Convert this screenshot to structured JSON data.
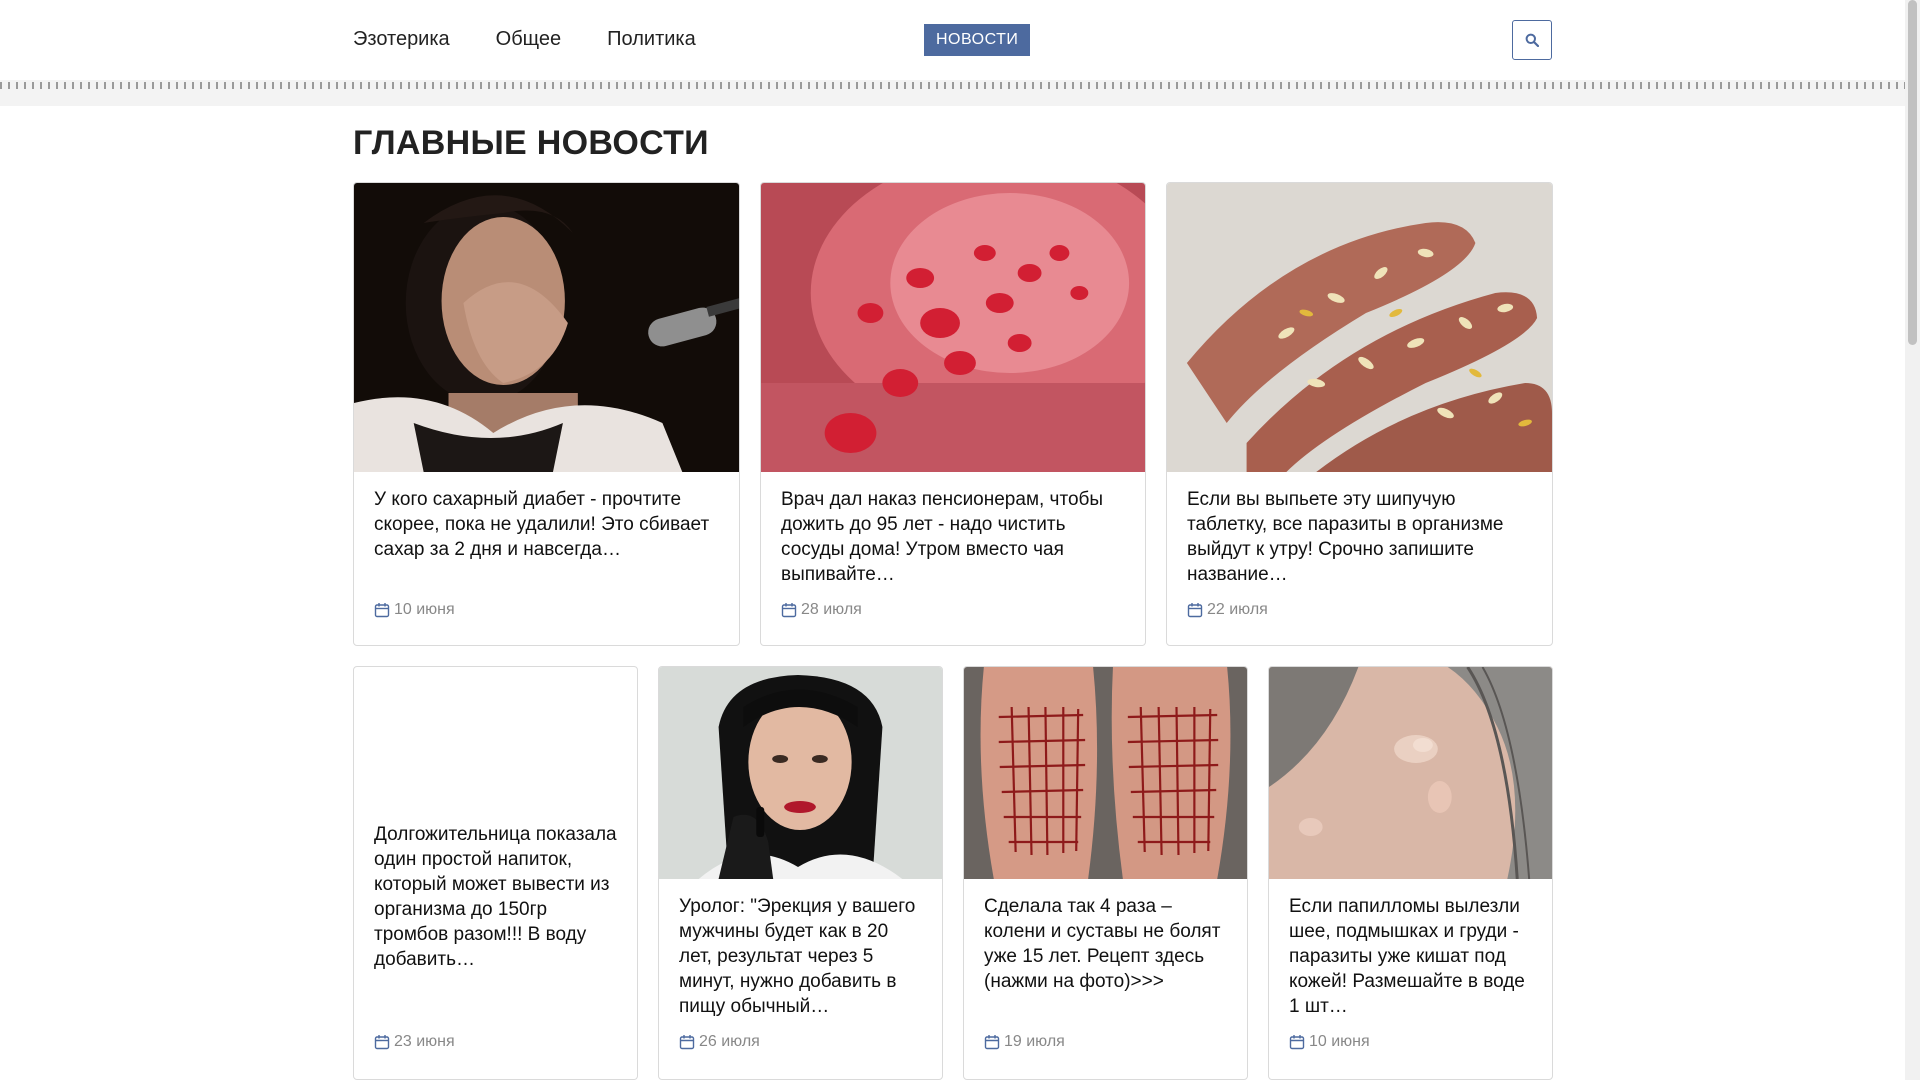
{
  "header": {
    "nav": [
      "Эзотерика",
      "Общее",
      "Политика"
    ],
    "news_button": "НОВОСТИ",
    "search_icon": "search-icon"
  },
  "section_title": "ГЛАВНЫЕ НОВОСТИ",
  "cards": [
    {
      "text": "У кого сахарный диабет - прочтите скорее, пока не удалили! Это сбивает сахар за 2 дня и навсегда…",
      "date": "10 июня",
      "image": "woman-covering-mouth-photo"
    },
    {
      "text": "Врач дал наказ пенсионерам, чтобы дожить до 95 лет - надо чистить сосуды дома! Утром вместо чая выпивайте…",
      "date": "28 июля",
      "image": "blood-cells-photo"
    },
    {
      "text": "Если вы выпьете эту шипучую таблетку, все паразиты в организме выйдут к утру! Срочно запишите название…",
      "date": "22 июля",
      "image": "parasites-on-fingers-photo"
    },
    {
      "text": "Долгожительница показала один простой напиток, который может вывести из организма до 150гр тромбов разом!!! В воду добавить…",
      "date": "23 июня",
      "image": ""
    },
    {
      "text": "Уролог: \"Эрекция у вашего мужчины будет как в 20 лет, результат через 5 минут, нужно добавить в пищу обычный…",
      "date": "26 июля",
      "image": "doctor-woman-photo"
    },
    {
      "text": "Сделала так 4 раза – колени и суставы не болят уже 15 лет. Рецепт здесь (нажми на фото)>>>",
      "date": "19 июля",
      "image": "knees-grid-photo"
    },
    {
      "text": "Если папилломы вылезли шее, подмышках и груди - паразиты уже кишат под кожей! Размешайте в воде 1 шт…",
      "date": "10 июня",
      "image": "papilloma-skin-photo"
    }
  ]
}
